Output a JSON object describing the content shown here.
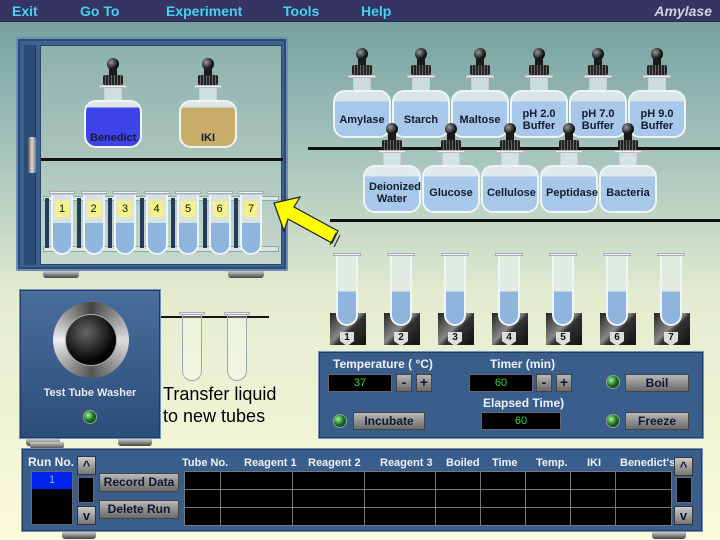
{
  "menu": {
    "items": [
      {
        "label": "Exit"
      },
      {
        "label": "Go To"
      },
      {
        "label": "Experiment"
      },
      {
        "label": "Tools"
      },
      {
        "label": "Help"
      }
    ],
    "app_title": "Amylase"
  },
  "cabinet": {
    "bottles": [
      {
        "label": "Benedict",
        "color": "#3e44ea"
      },
      {
        "label": "IKI",
        "color": "#c8ae6a"
      }
    ],
    "rack_tubes": [
      "1",
      "2",
      "3",
      "4",
      "5",
      "6",
      "7"
    ]
  },
  "reagents": {
    "top_row": [
      {
        "label": "Amylase"
      },
      {
        "label": "Starch"
      },
      {
        "label": "Maltose"
      },
      {
        "label": "pH 2.0 Buffer"
      },
      {
        "label": "pH 7.0 Buffer"
      },
      {
        "label": "pH 9.0 Buffer"
      }
    ],
    "bottom_row": [
      {
        "label": "Deionized Water"
      },
      {
        "label": "Glucose"
      },
      {
        "label": "Cellulose"
      },
      {
        "label": "Peptidase"
      },
      {
        "label": "Bacteria"
      }
    ]
  },
  "tube_holders": [
    "1",
    "2",
    "3",
    "4",
    "5",
    "6",
    "7"
  ],
  "washer": {
    "label": "Test Tube Washer"
  },
  "transfer": {
    "line1": "Transfer liquid",
    "line2": "to new tubes"
  },
  "controls": {
    "temperature_label": "Temperature ( °C)",
    "temperature_value": "37",
    "timer_label": "Timer (min)",
    "timer_value": "60",
    "elapsed_label": "Elapsed Time)",
    "elapsed_value": "60",
    "minus": "-",
    "plus": "+",
    "boil": "Boil",
    "freeze": "Freeze",
    "incubate": "Incubate"
  },
  "data_panel": {
    "run_label": "Run No.",
    "runs": [
      "1"
    ],
    "record_button": "Record Data",
    "delete_button": "Delete Run",
    "up": "^",
    "down": "v",
    "columns": [
      "Tube No.",
      "Reagent 1",
      "Reagent 2",
      "Reagent 3",
      "Boiled",
      "Time",
      "Temp.",
      "IKI",
      "Benedict's"
    ],
    "rows": [
      [
        "",
        "",
        "",
        "",
        "",
        "",
        "",
        "",
        ""
      ],
      [
        "",
        "",
        "",
        "",
        "",
        "",
        "",
        "",
        ""
      ],
      [
        "",
        "",
        "",
        "",
        "",
        "",
        "",
        "",
        ""
      ]
    ]
  }
}
